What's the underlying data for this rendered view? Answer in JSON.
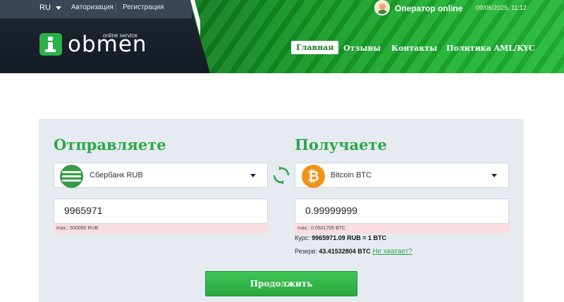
{
  "topbar": {
    "language": "RU",
    "login": "Авторизация",
    "register": "Регистрация",
    "operator": "Оператор online",
    "datetime": "09/06/2025, 11:12"
  },
  "logo": {
    "word": "obmen",
    "subtitle": "online service"
  },
  "nav": {
    "items": [
      {
        "label": "Главная",
        "active": true
      },
      {
        "label": "Отзывы"
      },
      {
        "label": "Контакты"
      },
      {
        "label": "Политика AML/KYC"
      }
    ]
  },
  "exchange": {
    "give": {
      "title": "Отправляете",
      "currency": "Сбербанк RUB",
      "amount": "9965971",
      "max": "max.: 500000 RUB"
    },
    "get": {
      "title": "Получаете",
      "currency": "Bitcoin BTC",
      "amount": "0.99999999",
      "max": "max.: 0.0501705 BTC"
    },
    "rate_label": "Курс:",
    "rate_value": "9965971.09 RUB = 1 BTC",
    "reserve_label": "Резерв:",
    "reserve_value": "43.41532804 BTC",
    "not_enough": "Не хватает?",
    "continue": "Продолжить"
  },
  "colors": {
    "accent_green": "#2ea84a",
    "header_dark": "#1f2733",
    "bitcoin_orange": "#f2931a",
    "error_bg": "#f9dde0"
  }
}
